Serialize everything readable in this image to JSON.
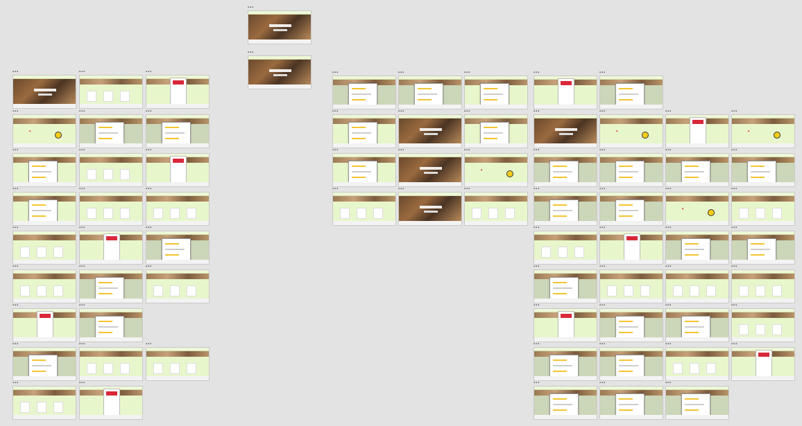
{
  "canvas": {
    "background": "#e3e3e3",
    "frame_color": "#e8f6cc",
    "frame_grey_color": "#ccd6b9",
    "accent_red": "#d9283a",
    "accent_yellow": "#f3cd1a"
  },
  "frames": [
    {
      "k": "hero",
      "g": false
    },
    {
      "k": "hero",
      "g": false
    },
    {
      "k": "hero",
      "g": false
    },
    {
      "k": "grid",
      "g": false
    },
    {
      "k": "panel",
      "g": false
    },
    {
      "k": "brand",
      "g": false
    },
    {
      "k": "modal",
      "g": true
    },
    {
      "k": "modal",
      "g": true
    },
    {
      "k": "modal",
      "g": false
    },
    {
      "k": "grid",
      "g": false
    },
    {
      "k": "panel",
      "g": false
    },
    {
      "k": "modal",
      "g": false
    },
    {
      "k": "grid",
      "g": false
    },
    {
      "k": "grid",
      "g": false
    },
    {
      "k": "grid",
      "g": false
    },
    {
      "k": "panel",
      "g": false
    },
    {
      "k": "modal",
      "g": true
    },
    {
      "k": "grid",
      "g": false
    },
    {
      "k": "modal",
      "g": true
    },
    {
      "k": "grid",
      "g": false
    },
    {
      "k": "panel",
      "g": false
    },
    {
      "k": "modal",
      "g": true
    },
    {
      "k": "modal",
      "g": true
    },
    {
      "k": "grid",
      "g": false
    },
    {
      "k": "grid",
      "g": false
    },
    {
      "k": "grid",
      "g": false
    },
    {
      "k": "panel",
      "g": false
    },
    {
      "k": "modal",
      "g": true
    },
    {
      "k": "modal",
      "g": true
    },
    {
      "k": "modal",
      "g": false
    },
    {
      "k": "modal",
      "g": false
    },
    {
      "k": "hero",
      "g": false
    },
    {
      "k": "modal",
      "g": false
    },
    {
      "k": "modal",
      "g": false
    },
    {
      "k": "hero",
      "g": false
    },
    {
      "k": "brand",
      "g": false
    },
    {
      "k": "grid",
      "g": false
    },
    {
      "k": "hero",
      "g": false
    },
    {
      "k": "grid",
      "g": false
    },
    {
      "k": "panel",
      "g": false
    },
    {
      "k": "modal",
      "g": true
    },
    {
      "k": "hero",
      "g": false
    },
    {
      "k": "brand",
      "g": false
    },
    {
      "k": "panel",
      "g": false
    },
    {
      "k": "brand",
      "g": false
    },
    {
      "k": "modal",
      "g": true
    },
    {
      "k": "modal",
      "g": true
    },
    {
      "k": "modal",
      "g": true
    },
    {
      "k": "modal",
      "g": true
    },
    {
      "k": "modal",
      "g": true
    },
    {
      "k": "modal",
      "g": true
    },
    {
      "k": "brand",
      "g": false
    },
    {
      "k": "grid",
      "g": false
    },
    {
      "k": "grid",
      "g": false
    },
    {
      "k": "panel",
      "g": false
    },
    {
      "k": "modal",
      "g": true
    },
    {
      "k": "modal",
      "g": true
    },
    {
      "k": "modal",
      "g": true
    },
    {
      "k": "grid",
      "g": false
    },
    {
      "k": "grid",
      "g": false
    },
    {
      "k": "grid",
      "g": false
    },
    {
      "k": "panel",
      "g": false
    },
    {
      "k": "modal",
      "g": true
    },
    {
      "k": "modal",
      "g": true
    },
    {
      "k": "grid",
      "g": false
    },
    {
      "k": "modal",
      "g": true
    },
    {
      "k": "modal",
      "g": true
    },
    {
      "k": "grid",
      "g": false
    },
    {
      "k": "panel",
      "g": false
    },
    {
      "k": "modal",
      "g": true
    },
    {
      "k": "modal",
      "g": true
    },
    {
      "k": "modal",
      "g": true
    },
    {
      "k": "grid",
      "g": false
    },
    {
      "k": "modal",
      "g": true
    },
    {
      "k": "grid",
      "g": false
    },
    {
      "k": "grid",
      "g": false
    },
    {
      "k": "grid",
      "g": false
    },
    {
      "k": "brand",
      "g": false
    },
    {
      "k": "panel",
      "g": false
    }
  ]
}
